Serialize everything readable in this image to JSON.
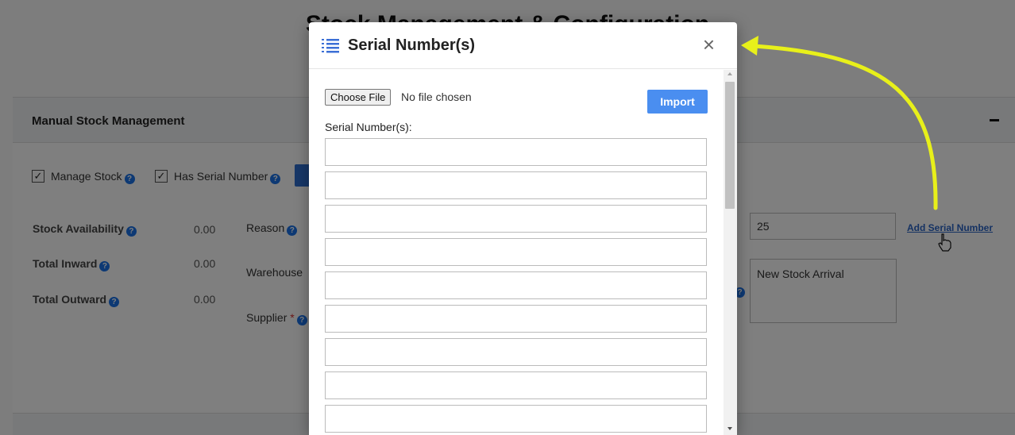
{
  "page": {
    "title": "Stock Management & Configuration",
    "section_title": "Manual Stock Management"
  },
  "form": {
    "manage_stock_label": "Manage Stock",
    "has_serial_label": "Has Serial Number",
    "stock_availability_label": "Stock Availability",
    "stock_availability_value": "0.00",
    "total_inward_label": "Total Inward",
    "total_inward_value": "0.00",
    "total_outward_label": "Total Outward",
    "total_outward_value": "0.00",
    "reason_label": "Reason",
    "warehouse_label": "Warehouse",
    "supplier_label": "Supplier",
    "required_mark": "*",
    "quantity_value": "25",
    "remarks_value": "New Stock Arrival",
    "add_serial_link": "Add Serial Number",
    "check_mark": "✓",
    "help_glyph": "?"
  },
  "modal": {
    "title": "Serial Number(s)",
    "close_glyph": "×",
    "choose_file_label": "Choose File",
    "file_status": "No file chosen",
    "import_label": "Import",
    "serial_label": "Serial Number(s):",
    "serial_inputs": [
      "",
      "",
      "",
      "",
      "",
      "",
      "",
      "",
      ""
    ]
  },
  "colors": {
    "accent": "#4a8ef0",
    "help_icon": "#1a73e8",
    "link": "#2a64c6",
    "annotation_arrow": "#e8f01a"
  },
  "icons": {
    "modal_icon": "list-icon",
    "close": "close-icon",
    "help": "help-icon",
    "cursor": "hand-pointer-icon"
  }
}
